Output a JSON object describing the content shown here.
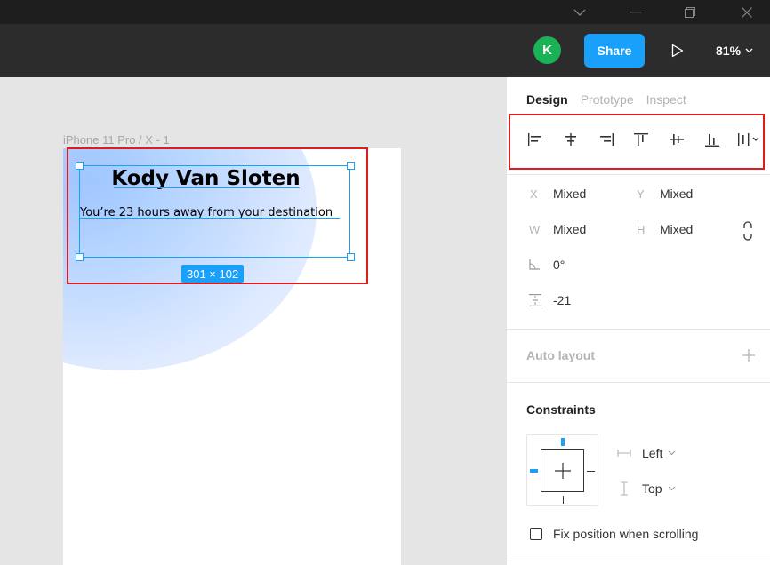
{
  "toolbar": {
    "avatar_initial": "K",
    "share_label": "Share",
    "zoom": "81%"
  },
  "canvas": {
    "frame_label": "iPhone 11 Pro / X - 1",
    "selected_title": "Kody Van Sloten",
    "selected_subtitle": "You’re 23 hours away from your destination",
    "size_badge": "301 × 102"
  },
  "panel": {
    "tabs": [
      "Design",
      "Prototype",
      "Inspect"
    ],
    "alignment_buttons": [
      "align-left",
      "align-horizontal-center",
      "align-right",
      "align-top",
      "align-vertical-center",
      "align-bottom",
      "distribute-spacing"
    ],
    "props": {
      "x_label": "X",
      "x_value": "Mixed",
      "y_label": "Y",
      "y_value": "Mixed",
      "w_label": "W",
      "w_value": "Mixed",
      "h_label": "H",
      "h_value": "Mixed",
      "rotation": "0°",
      "spacing": "-21"
    },
    "auto_layout_label": "Auto layout",
    "constraints_label": "Constraints",
    "constraint_horizontal": "Left",
    "constraint_vertical": "Top",
    "fix_position_label": "Fix position when scrolling"
  },
  "colors": {
    "accent": "#18a0fb",
    "highlight": "#e01b1b",
    "avatar": "#1bb156"
  }
}
